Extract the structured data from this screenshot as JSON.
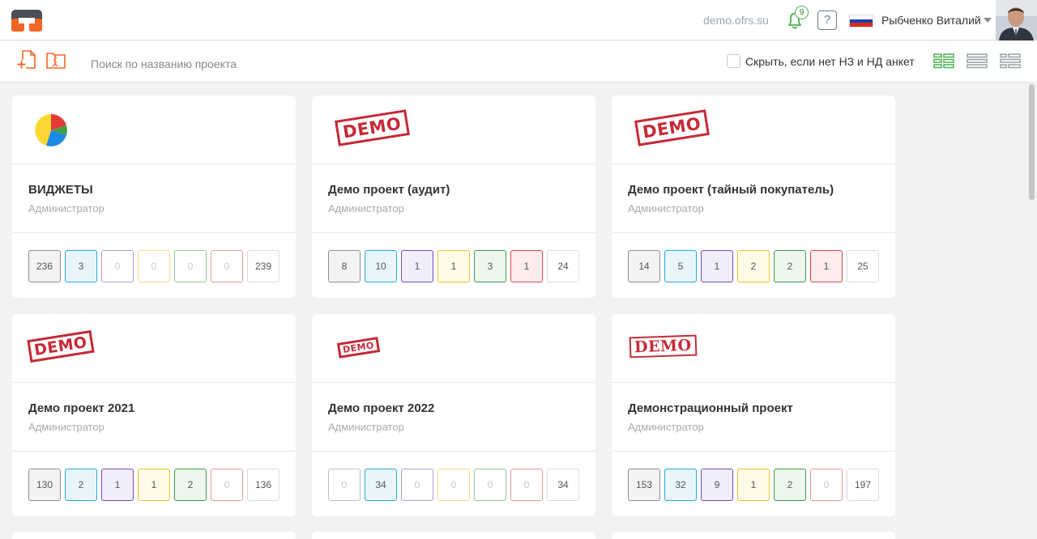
{
  "header": {
    "domain": "demo.ofrs.su",
    "notifications_count": "9",
    "help_label": "?",
    "user_name": "Рыбченко Виталий",
    "language_flag_colors": [
      "#ffffff",
      "#1c3fae",
      "#d52b1e"
    ]
  },
  "toolbar": {
    "search_placeholder": "Поиск по названию проекта",
    "hide_label": "Скрыть, если нет НЗ и НД анкет"
  },
  "stat_palette": [
    {
      "border": "#8d8d8d",
      "bg": "#f3f3f3"
    },
    {
      "border": "#29a8d8",
      "bg": "#e8f6fc"
    },
    {
      "border": "#6c4fb5",
      "bg": "#f1edfb"
    },
    {
      "border": "#e6c22e",
      "bg": "#fffbe8"
    },
    {
      "border": "#3e9b4f",
      "bg": "#edf7ee"
    },
    {
      "border": "#d54848",
      "bg": "#fdecec"
    },
    {
      "border": "#dcdcdc",
      "bg": "#ffffff"
    }
  ],
  "projects": [
    {
      "title": "ВИДЖЕТЫ",
      "role": "Администратор",
      "logo": "pie-chart-icon",
      "stats": [
        "236",
        "3",
        "0",
        "0",
        "0",
        "0",
        "239"
      ]
    },
    {
      "title": "Демо проект (аудит)",
      "role": "Администратор",
      "logo": "demo-stamp",
      "stats": [
        "8",
        "10",
        "1",
        "1",
        "3",
        "1",
        "24"
      ]
    },
    {
      "title": "Демо проект (тайный покупатель)",
      "role": "Администратор",
      "logo": "demo-stamp",
      "stats": [
        "14",
        "5",
        "1",
        "2",
        "2",
        "1",
        "25"
      ]
    },
    {
      "title": "Демо проект 2021",
      "role": "Администратор",
      "logo": "demo-stamp",
      "stats": [
        "130",
        "2",
        "1",
        "1",
        "2",
        "0",
        "136"
      ]
    },
    {
      "title": "Демо проект 2022",
      "role": "Администратор",
      "logo": "demo-stamp",
      "stats": [
        "0",
        "34",
        "0",
        "0",
        "0",
        "0",
        "34"
      ]
    },
    {
      "title": "Демонстрационный проект",
      "role": "Администратор",
      "logo": "demo-stamp",
      "stats": [
        "153",
        "32",
        "9",
        "1",
        "2",
        "0",
        "197"
      ]
    }
  ],
  "stamp_text": "DEMO"
}
